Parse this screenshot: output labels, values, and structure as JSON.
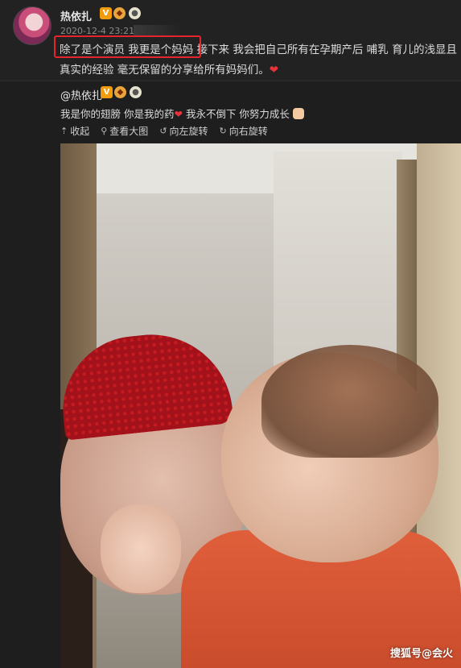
{
  "post": {
    "username": "热依扎",
    "timestamp": "2020-12-4 23:21",
    "content_highlight": "除了是个演员 我更是个妈妈",
    "content_rest": " 接下来 我会把自己所有在孕期产后 哺乳 育儿的浅显且真实的经验 毫无保留的分享给所有妈妈们。",
    "heart": "❤"
  },
  "repost": {
    "username": "@热依扎",
    "text": "我是你的翅膀 你是我的药",
    "heart": "❤",
    "text2": " 我永不倒下 你努力成长"
  },
  "toolbar": {
    "collapse_label": "收起",
    "view_large_label": "查看大图",
    "rotate_left_label": "向左旋转",
    "rotate_right_label": "向右旋转"
  },
  "icons": {
    "collapse": "collapse-icon",
    "view_large": "magnifier-icon",
    "rotate_left": "rotate-left-icon",
    "rotate_right": "rotate-right-icon"
  },
  "photo": {
    "watermark": "搜狐号@会火"
  },
  "colors": {
    "background": "#1e1e1e",
    "highlight_border": "#e4252c",
    "heart": "#e8333d",
    "vip_badge": "#f29b0c"
  }
}
